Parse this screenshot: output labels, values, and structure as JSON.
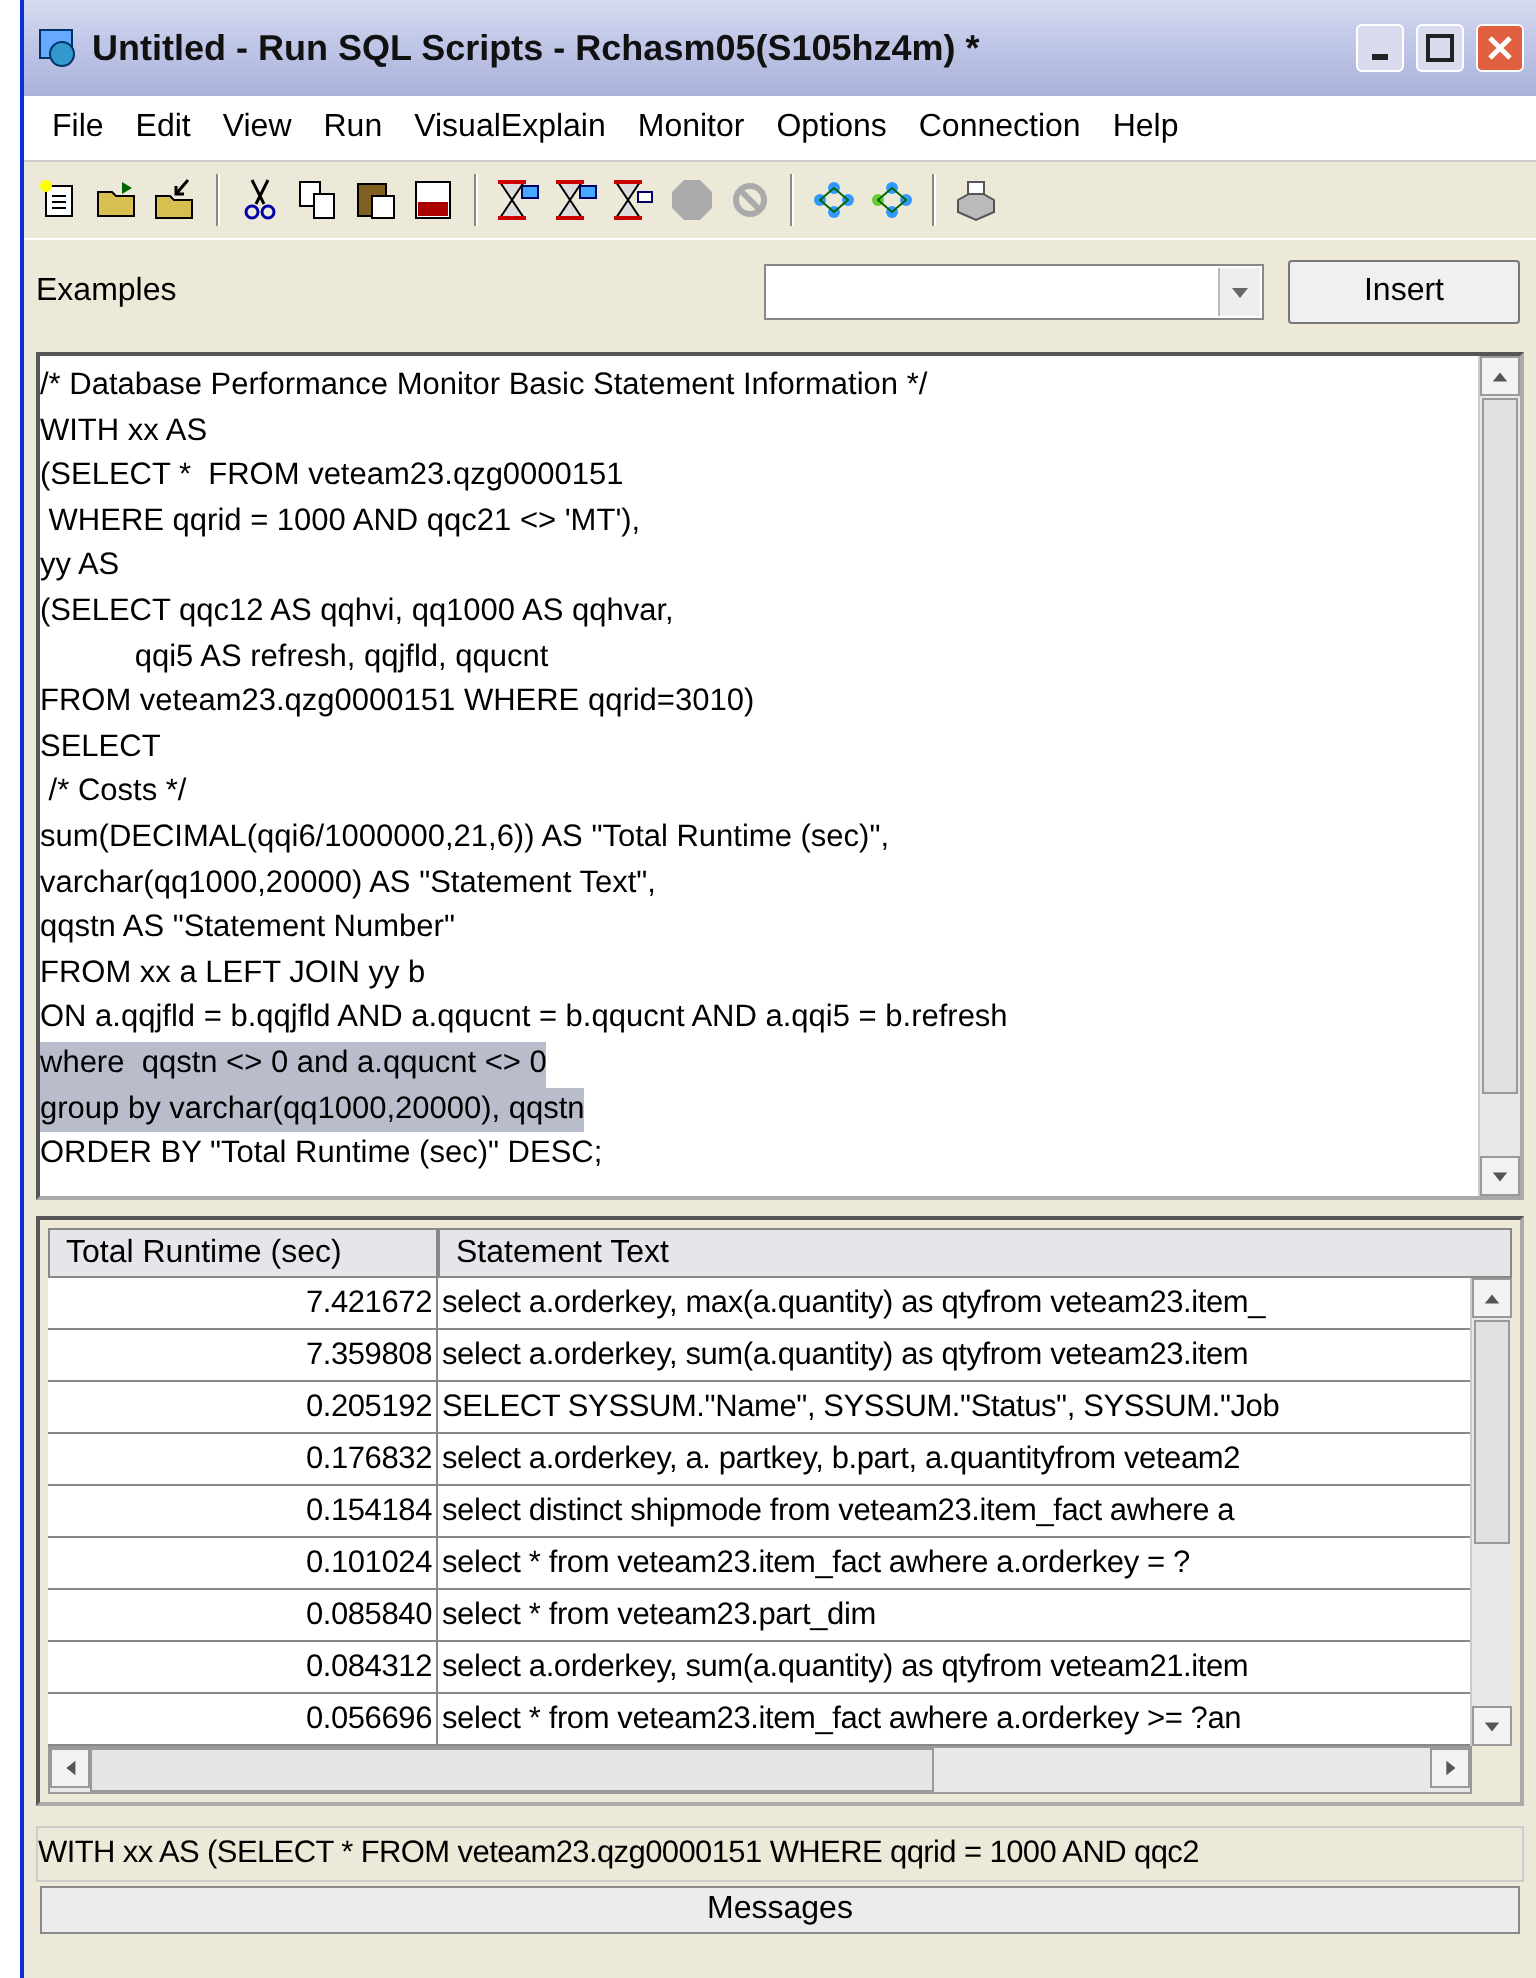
{
  "window": {
    "title": "Untitled - Run SQL Scripts - Rchasm05(S105hz4m) *"
  },
  "menu": [
    "File",
    "Edit",
    "View",
    "Run",
    "VisualExplain",
    "Monitor",
    "Options",
    "Connection",
    "Help"
  ],
  "examples": {
    "label": "Examples",
    "insert_button": "Insert"
  },
  "editor": {
    "lines": [
      {
        "text": "/* Database Performance Monitor Basic Statement Information */",
        "selected": false
      },
      {
        "text": "WITH xx AS",
        "selected": false
      },
      {
        "text": "(SELECT *  FROM veteam23.qzg0000151",
        "selected": false
      },
      {
        "text": " WHERE qqrid = 1000 AND qqc21 <> 'MT'),",
        "selected": false
      },
      {
        "text": "yy AS",
        "selected": false
      },
      {
        "text": "(SELECT qqc12 AS qqhvi, qq1000 AS qqhvar,",
        "selected": false
      },
      {
        "text": "           qqi5 AS refresh, qqjfld, qqucnt",
        "selected": false
      },
      {
        "text": "FROM veteam23.qzg0000151 WHERE qqrid=3010)",
        "selected": false
      },
      {
        "text": "SELECT",
        "selected": false
      },
      {
        "text": " /* Costs */",
        "selected": false
      },
      {
        "text": "sum(DECIMAL(qqi6/1000000,21,6)) AS \"Total Runtime (sec)\",",
        "selected": false
      },
      {
        "text": "varchar(qq1000,20000) AS \"Statement Text\",",
        "selected": false
      },
      {
        "text": "qqstn AS \"Statement Number\"",
        "selected": false
      },
      {
        "text": "FROM xx a LEFT JOIN yy b",
        "selected": false
      },
      {
        "text": "ON a.qqjfld = b.qqjfld AND a.qqucnt = b.qqucnt AND a.qqi5 = b.refresh",
        "selected": false
      },
      {
        "text": "where  qqstn <> 0 and a.qqucnt <> 0",
        "selected": true
      },
      {
        "text": "group by varchar(qq1000,20000), qqstn",
        "selected": true
      },
      {
        "text": "ORDER BY \"Total Runtime (sec)\" DESC;",
        "selected": false
      }
    ]
  },
  "results": {
    "columns": [
      "Total Runtime (sec)",
      "Statement Text"
    ],
    "rows": [
      [
        "7.421672",
        "select a.orderkey, max(a.quantity) as qtyfrom veteam23.item_"
      ],
      [
        "7.359808",
        "select a.orderkey, sum(a.quantity) as qtyfrom veteam23.item"
      ],
      [
        "0.205192",
        "SELECT SYSSUM.\"Name\", SYSSUM.\"Status\", SYSSUM.\"Job"
      ],
      [
        "0.176832",
        "select  a.orderkey, a. partkey, b.part, a.quantityfrom  veteam2"
      ],
      [
        "0.154184",
        "select distinct shipmode from veteam23.item_fact awhere a"
      ],
      [
        "0.101024",
        "select * from veteam23.item_fact awhere a.orderkey = ?"
      ],
      [
        "0.085840",
        "select * from veteam23.part_dim"
      ],
      [
        "0.084312",
        "select a.orderkey, sum(a.quantity) as qtyfrom veteam21.item"
      ],
      [
        "0.056696",
        "select * from veteam23.item_fact awhere a.orderkey >= ?an"
      ]
    ]
  },
  "status_text": "WITH xx AS   (SELECT *  FROM veteam23.qzg0000151 WHERE qqrid = 1000 AND qqc2",
  "messages_button": "Messages"
}
